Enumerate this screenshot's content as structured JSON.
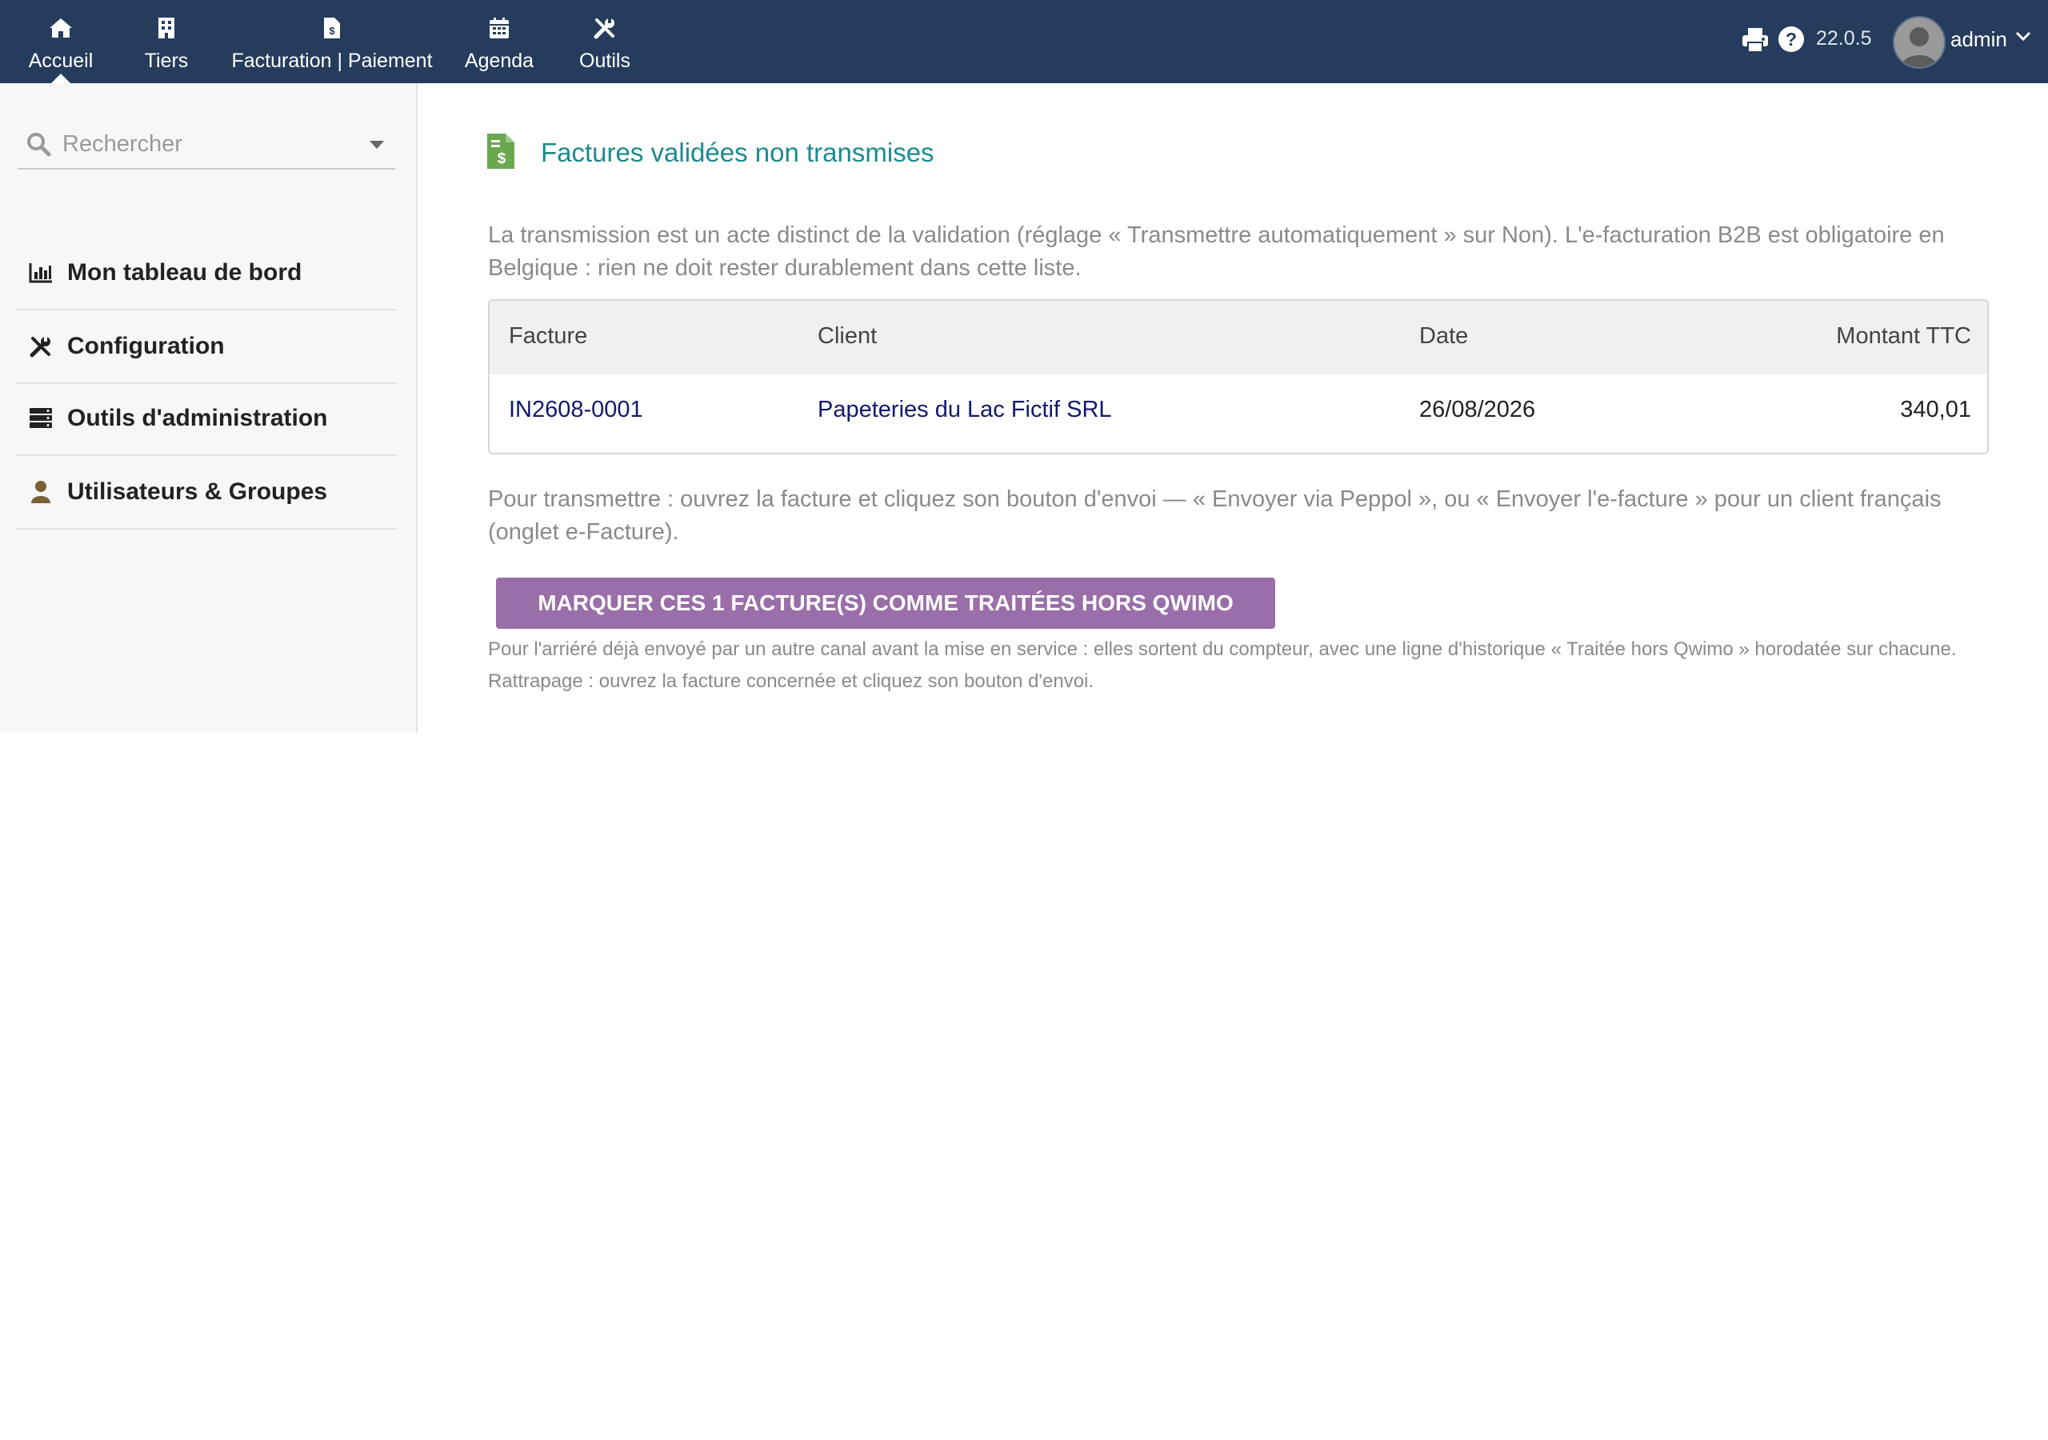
{
  "topbar": {
    "nav": [
      {
        "label": "Accueil",
        "icon": "home-icon"
      },
      {
        "label": "Tiers",
        "icon": "building-icon"
      },
      {
        "label": "Facturation | Paiement",
        "icon": "invoice-icon"
      },
      {
        "label": "Agenda",
        "icon": "calendar-icon"
      },
      {
        "label": "Outils",
        "icon": "tools-icon"
      }
    ],
    "version": "22.0.5",
    "user": "admin",
    "colors": {
      "background": "#263c5c"
    }
  },
  "sidebar": {
    "search": {
      "placeholder": "Rechercher"
    },
    "items": [
      {
        "label": "Mon tableau de bord",
        "icon": "chart-bar-icon"
      },
      {
        "label": "Configuration",
        "icon": "tools-icon"
      },
      {
        "label": "Outils d'administration",
        "icon": "server-icon"
      },
      {
        "label": "Utilisateurs & Groupes",
        "icon": "user-icon"
      }
    ]
  },
  "main": {
    "title": "Factures validées non transmises",
    "intro": "La transmission est un acte distinct de la validation (réglage « Transmettre automatiquement » sur Non). L'e-facturation B2B est obligatoire en Belgique : rien ne doit rester durablement dans cette liste.",
    "table": {
      "headers": [
        "Facture",
        "Client",
        "Date",
        "Montant TTC"
      ],
      "rows": [
        [
          "IN2608-0001",
          "Papeteries du Lac Fictif SRL",
          "26/08/2026",
          "340,01"
        ]
      ]
    },
    "instructions": "Pour transmettre : ouvrez la facture et cliquez son bouton d'envoi — « Envoyer via Peppol », ou « Envoyer l'e-facture » pour un client français (onglet e-Facture).",
    "button_label": "MARQUER CES 1 FACTURE(S) COMME TRAITÉES HORS QWIMO",
    "note": "Pour l'arriéré déjà envoyé par un autre canal avant la mise en service : elles sortent du compteur, avec une ligne d'historique « Traitée hors Qwimo » horodatée sur chacune. Rattrapage : ouvrez la facture concernée et cliquez son bouton d'envoi.",
    "colors": {
      "title": "#1c8a8f",
      "button": "#9a6ea8",
      "link": "#12196b"
    }
  }
}
